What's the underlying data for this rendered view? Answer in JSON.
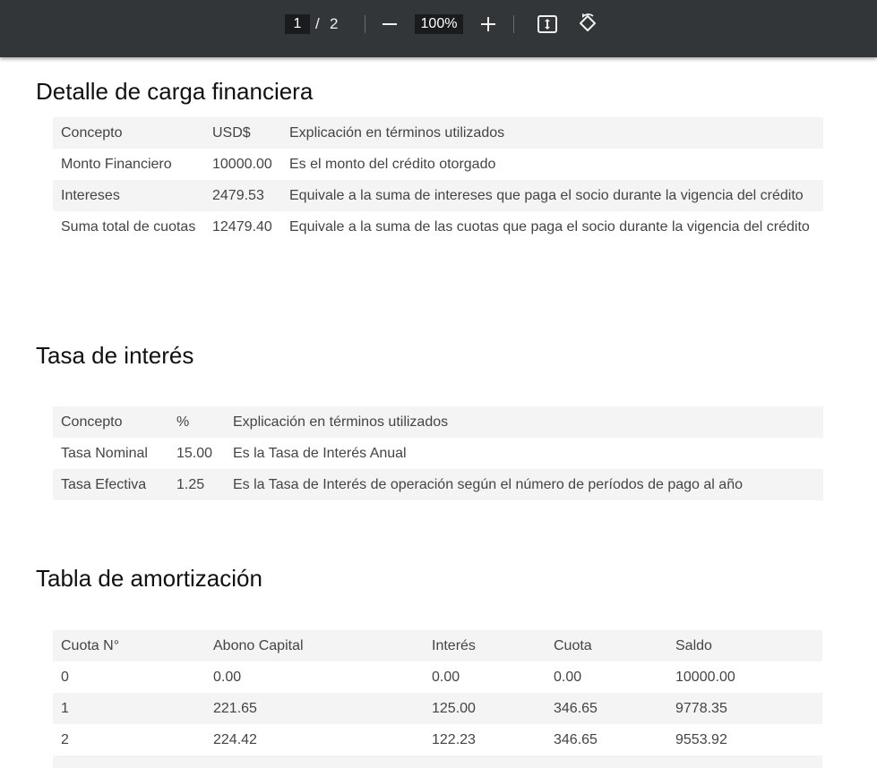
{
  "toolbar": {
    "page_current": "1",
    "page_separator": "/",
    "page_total": "2",
    "zoom": "100%"
  },
  "sections": {
    "carga_title": "Detalle de carga financiera",
    "tasa_title": "Tasa de interés",
    "amort_title": "Tabla de amortización"
  },
  "carga_table": {
    "headers": [
      "Concepto",
      "USD$",
      "Explicación en términos utilizados"
    ],
    "rows": [
      [
        "Monto Financiero",
        "10000.00",
        "Es el monto del crédito otorgado"
      ],
      [
        "Intereses",
        "2479.53",
        "Equivale a la suma de intereses que paga el socio durante la vigencia del crédito"
      ],
      [
        "Suma total de cuotas",
        "12479.40",
        "Equivale a la suma de las cuotas que paga el socio durante la vigencia del crédito"
      ]
    ]
  },
  "tasa_table": {
    "headers": [
      "Concepto",
      "%",
      "Explicación en términos utilizados"
    ],
    "rows": [
      [
        "Tasa Nominal",
        "15.00",
        "Es la Tasa de Interés Anual"
      ],
      [
        "Tasa Efectiva",
        "1.25",
        "Es la Tasa de Interés de operación según el número de períodos de pago al año"
      ]
    ]
  },
  "amort_table": {
    "headers": [
      "Cuota N°",
      "Abono Capital",
      "Interés",
      "Cuota",
      "Saldo"
    ],
    "rows": [
      [
        "0",
        "0.00",
        "0.00",
        "0.00",
        "10000.00"
      ],
      [
        "1",
        "221.65",
        "125.00",
        "346.65",
        "9778.35"
      ],
      [
        "2",
        "224.42",
        "122.23",
        "346.65",
        "9553.92"
      ]
    ]
  }
}
